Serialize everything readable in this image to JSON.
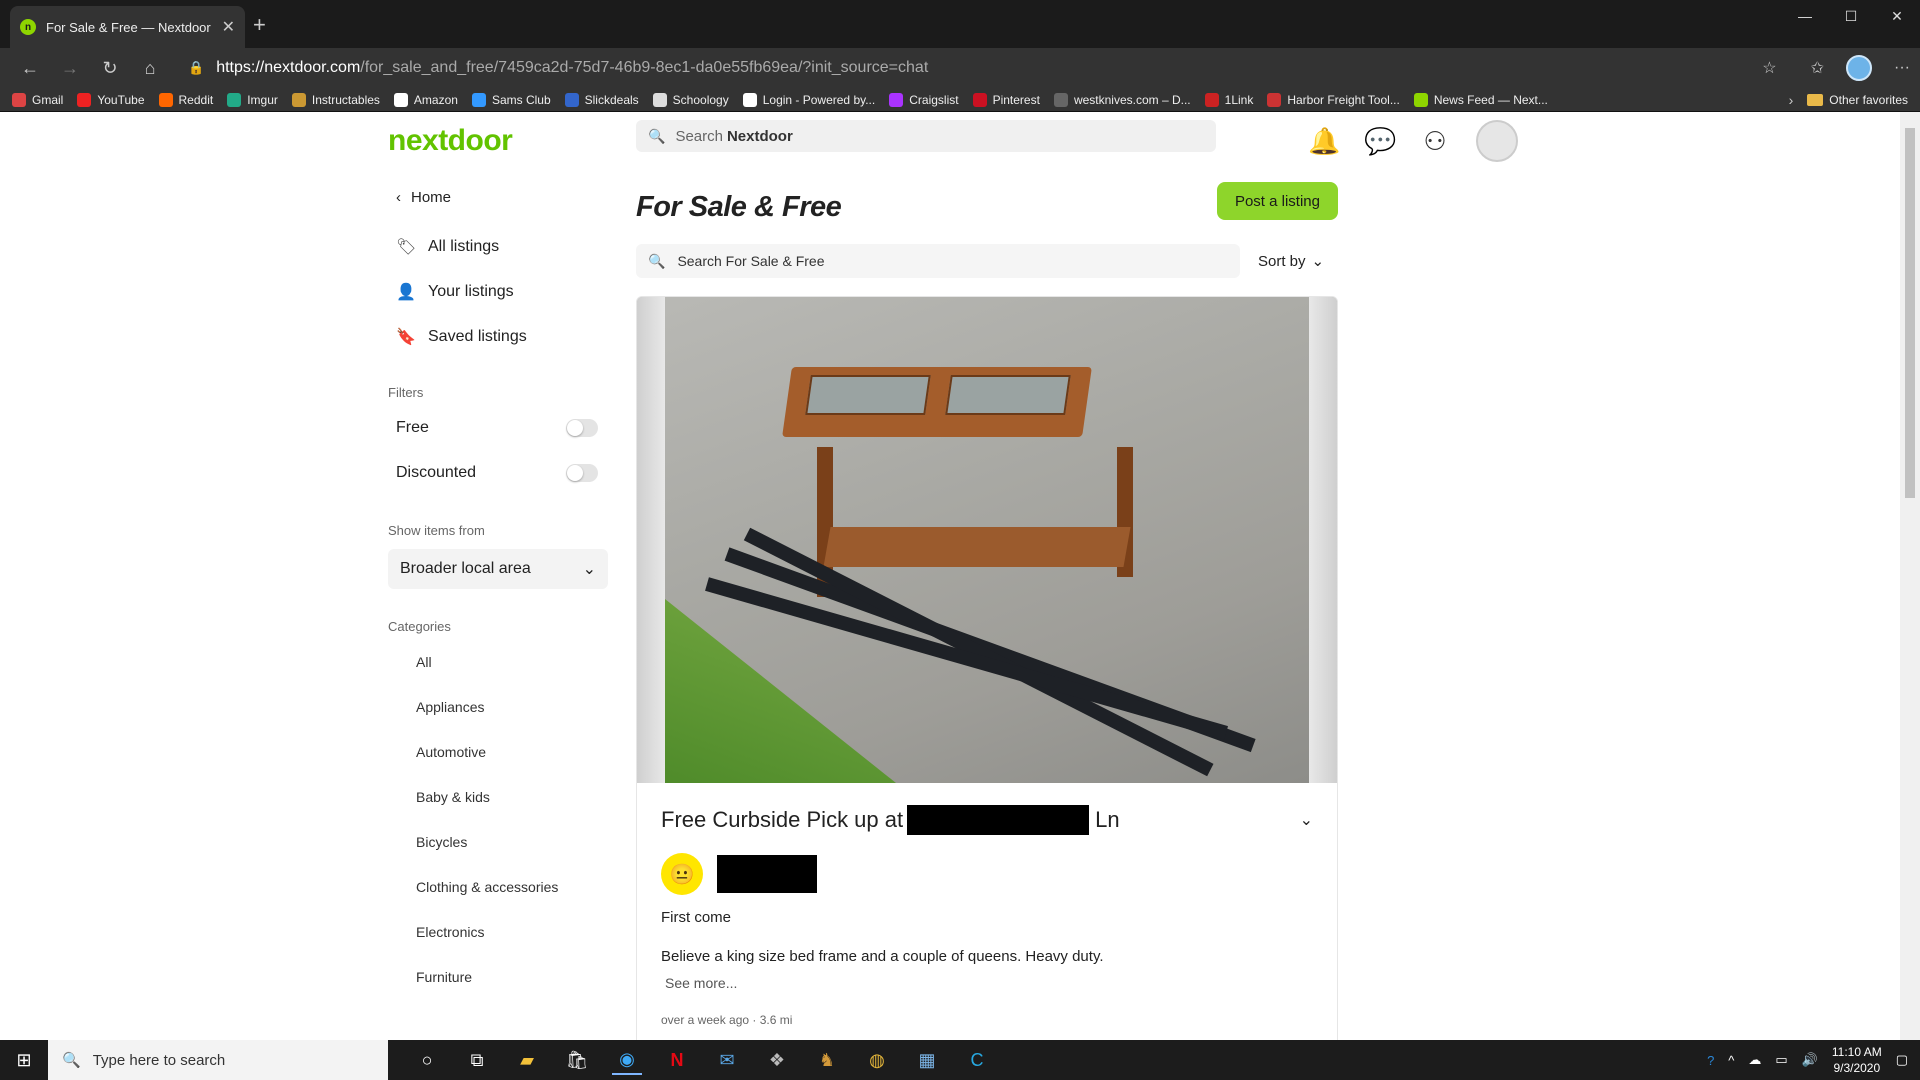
{
  "browser": {
    "tab_title": "For Sale & Free — Nextdoor",
    "tab_favicon": "n",
    "url_host": "https://nextdoor.com",
    "url_path": "/for_sale_and_free/7459ca2d-75d7-46b9-8ec1-da0e55fb69ea/?init_source=chat",
    "bookmarks": [
      "Gmail",
      "YouTube",
      "Reddit",
      "Imgur",
      "Instructables",
      "Amazon",
      "Sams Club",
      "Slickdeals",
      "Schoology",
      "Login - Powered by...",
      "Craigslist",
      "Pinterest",
      "westknives.com – D...",
      "1Link",
      "Harbor Freight Tool...",
      "News Feed — Next..."
    ],
    "other_favorites": "Other favorites"
  },
  "header": {
    "logo": "nextdoor",
    "search_prefix": "Search",
    "search_brand": "Nextdoor"
  },
  "sidebar": {
    "home": "Home",
    "all_listings": "All listings",
    "your_listings": "Your listings",
    "saved_listings": "Saved listings",
    "filters_label": "Filters",
    "filter_free": "Free",
    "filter_discounted": "Discounted",
    "show_from_label": "Show items from",
    "show_from_value": "Broader local area",
    "categories_label": "Categories",
    "categories": [
      "All",
      "Appliances",
      "Automotive",
      "Baby & kids",
      "Bicycles",
      "Clothing & accessories",
      "Electronics",
      "Furniture"
    ]
  },
  "main": {
    "title": "For Sale & Free",
    "post_button": "Post a listing",
    "search_placeholder": "Search For Sale & Free",
    "sort_label": "Sort by",
    "listing": {
      "title_prefix": "Free Curbside Pick up at",
      "title_suffix": "Ln",
      "subtitle": "First come",
      "description": "Believe a king size bed frame and a couple of queens. Heavy duty.",
      "see_more": "See more...",
      "meta": "over a week ago · 3.6 mi"
    }
  },
  "taskbar": {
    "search_placeholder": "Type here to search",
    "time": "11:10 AM",
    "date": "9/3/2020"
  },
  "colors": {
    "brand_green": "#62c300",
    "button_green": "#8ed52b"
  }
}
